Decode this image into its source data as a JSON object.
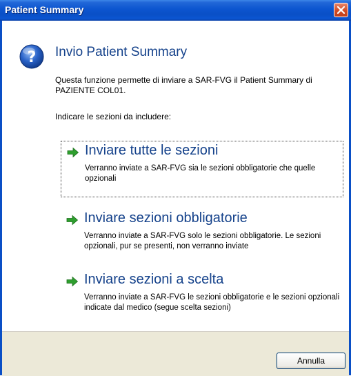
{
  "window": {
    "title": "Patient Summary"
  },
  "dialog": {
    "heading": "Invio Patient Summary",
    "description": "Questa funzione permette di inviare a SAR-FVG il Patient Summary di PAZIENTE COL01.",
    "instruction": "Indicare le sezioni da includere:"
  },
  "options": [
    {
      "title": "Inviare tutte le sezioni",
      "description": "Verranno inviate a SAR-FVG sia le sezioni obbligatorie che quelle opzionali"
    },
    {
      "title": "Inviare sezioni obbligatorie",
      "description": "Verranno inviate a SAR-FVG solo le sezioni obbligatorie. Le sezioni opzionali, pur se presenti, non verranno inviate"
    },
    {
      "title": "Inviare sezioni a scelta",
      "description": "Verranno inviate a SAR-FVG le sezioni obbligatorie e le sezioni opzionali indicate dal medico (segue scelta sezioni)"
    }
  ],
  "footer": {
    "cancel_label": "Annulla"
  },
  "icons": {
    "help": "question-icon",
    "option_arrow": "green-arrow-icon",
    "close": "close-icon"
  },
  "colors": {
    "titlebar": "#0a4fc6",
    "heading": "#15428b",
    "arrow": "#2e9e2e",
    "close": "#d24a22"
  }
}
